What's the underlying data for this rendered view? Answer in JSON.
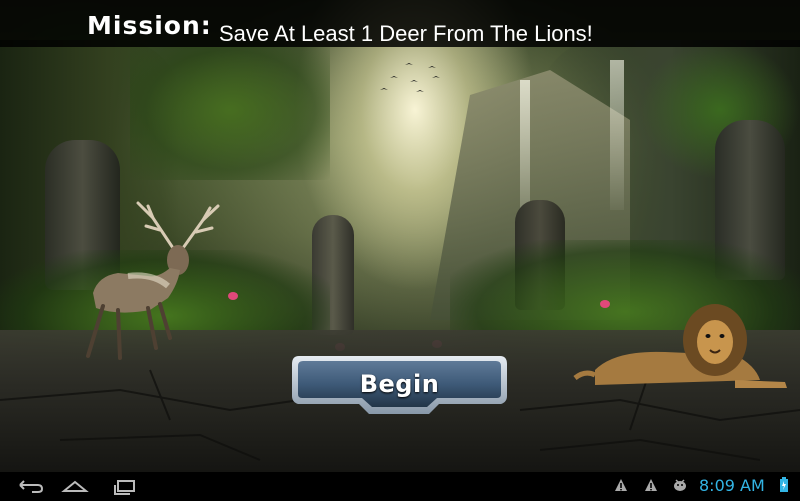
{
  "mission": {
    "label": "Mission:",
    "text": "Save At Least 1 Deer From The Lions!"
  },
  "begin_button": {
    "label": "Begin"
  },
  "status_bar": {
    "time": "8:09 AM",
    "icons": [
      "back-icon",
      "home-icon",
      "recent-apps-icon",
      "warning-icon",
      "warning-icon",
      "android-debug-icon",
      "battery-icon"
    ]
  },
  "scene": {
    "characters": [
      "deer",
      "lion"
    ]
  },
  "colors": {
    "time": "#33b5e5",
    "button_face": "#3e5a78",
    "button_border": "#c9d4dd"
  }
}
